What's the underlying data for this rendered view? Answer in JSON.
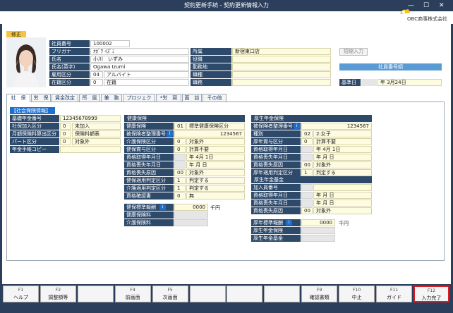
{
  "window": {
    "title": "契約更新手続 - 契約更新情報入力",
    "company": "OBC商事株式会社",
    "minimize": "—",
    "maximize": "☐",
    "close": "✕"
  },
  "status_badge": "修正",
  "employee": {
    "fields": [
      {
        "label": "社員番号",
        "value": "100002"
      },
      {
        "label": "フリガナ",
        "value": "ｵｶﾞﾜ ｲｽﾞﾐ"
      },
      {
        "label": "氏名",
        "value": "小川　いずみ"
      },
      {
        "label": "氏名(英字)",
        "value": "Ogawa Izumi"
      }
    ],
    "employment_label": "雇用区分",
    "employment_code": "04",
    "employment_value": "アルバイト",
    "status_label": "在籍区分",
    "status_code": "0",
    "status_value": "在籍",
    "right": [
      {
        "label": "所属",
        "value": "新宿東口店"
      },
      {
        "label": "役職",
        "value": ""
      },
      {
        "label": "勤務地",
        "value": ""
      },
      {
        "label": "職種",
        "value": ""
      },
      {
        "label": "職務",
        "value": ""
      }
    ],
    "short_input": "短縮入力",
    "emp_number_order": "社員番号順",
    "base_date_label": "基準日",
    "base_date_value": "年  3月24日"
  },
  "tabs": [
    "社　保",
    "労　保",
    "賃金改定",
    "所　属",
    "兼　務",
    "プロジェク",
    "*労　契",
    "面　談",
    "その他"
  ],
  "social": {
    "title": "【社会保険情報】",
    "rows": [
      {
        "label": "基礎年金番号",
        "code": "",
        "value": "12345678999"
      },
      {
        "label": "社保加入区分",
        "code": "0",
        "value": "未加入"
      },
      {
        "label": "月額保険料算出区分",
        "code": "0",
        "value": "保険料額表"
      },
      {
        "label": "パート区分",
        "code": "0",
        "value": "対象外"
      },
      {
        "label": "年金手帳コピー",
        "code": "",
        "value": ""
      }
    ]
  },
  "health": {
    "title": "健康保険",
    "rows": [
      {
        "label": "健康保険",
        "code": "01",
        "value": "標準健康保険区分"
      },
      {
        "label": "被保険者整理番号",
        "code": "",
        "value": "1234567"
      },
      {
        "label": "介護保険区分",
        "code": "0",
        "value": "対象外"
      },
      {
        "label": "健保賞与区分",
        "code": "0",
        "value": "計算不要"
      },
      {
        "label": "資格取得年月日",
        "code": "",
        "value": "年  4月  1日"
      },
      {
        "label": "資格喪失年月日",
        "code": "",
        "value": "年    月    日"
      },
      {
        "label": "資格喪失原因",
        "code": "00",
        "value": "対象外"
      },
      {
        "label": "健保適用判定区分",
        "code": "1",
        "value": "判定する"
      },
      {
        "label": "介護適用判定区分",
        "code": "1",
        "value": "判定する"
      },
      {
        "label": "資格確認書",
        "code": "0",
        "value": "無"
      }
    ],
    "std_label": "健保標準報酬",
    "std_value": "0000",
    "unit": "千円",
    "premium_label": "健康保険料",
    "care_label": "介護保険料"
  },
  "pension": {
    "title": "厚生年金保険",
    "rows": [
      {
        "label": "被保険者整理番号",
        "code": "",
        "value": "1234567"
      },
      {
        "label": "種別",
        "code": "02",
        "value": "2:女子"
      },
      {
        "label": "厚年賞与区分",
        "code": "0",
        "value": "計算不要"
      },
      {
        "label": "資格取得年月日",
        "code": "",
        "value": "年  4月  1日"
      },
      {
        "label": "資格喪失年月日",
        "code": "",
        "value": "年    月    日"
      },
      {
        "label": "資格喪失原因",
        "code": "00",
        "value": "対象外"
      },
      {
        "label": "厚年適用判定区分",
        "code": "1",
        "value": "判定する"
      }
    ],
    "fund_title": "厚生年金基金",
    "fund_rows": [
      {
        "label": "加入員番号",
        "code": "",
        "value": ""
      },
      {
        "label": "資格取得年月日",
        "code": "",
        "value": "年    月    日"
      },
      {
        "label": "資格喪失年月日",
        "code": "",
        "value": "年    月    日"
      },
      {
        "label": "資格喪失原因",
        "code": "00",
        "value": "対象外"
      }
    ],
    "std_label": "厚年標準報酬",
    "std_value": "0000",
    "unit": "千円",
    "premium_label": "厚生年金保険",
    "fund_label": "厚生年金基金"
  },
  "fkeys": [
    {
      "key": "F1",
      "label": "ヘルプ"
    },
    {
      "key": "F2",
      "label": "調整額等"
    },
    {
      "key": "",
      "label": ""
    },
    {
      "key": "F4",
      "label": "前画面"
    },
    {
      "key": "F5",
      "label": "次画面"
    },
    {
      "key": "",
      "label": ""
    },
    {
      "key": "",
      "label": ""
    },
    {
      "key": "",
      "label": ""
    },
    {
      "key": "F9",
      "label": "確認書類"
    },
    {
      "key": "F10",
      "label": "中止"
    },
    {
      "key": "F11",
      "label": "ガイド"
    },
    {
      "key": "F12",
      "label": "入力完了"
    }
  ],
  "colors": {
    "header": "#2b3f5c",
    "label": "#2e4a6b",
    "highlight": "#e01b1b"
  }
}
